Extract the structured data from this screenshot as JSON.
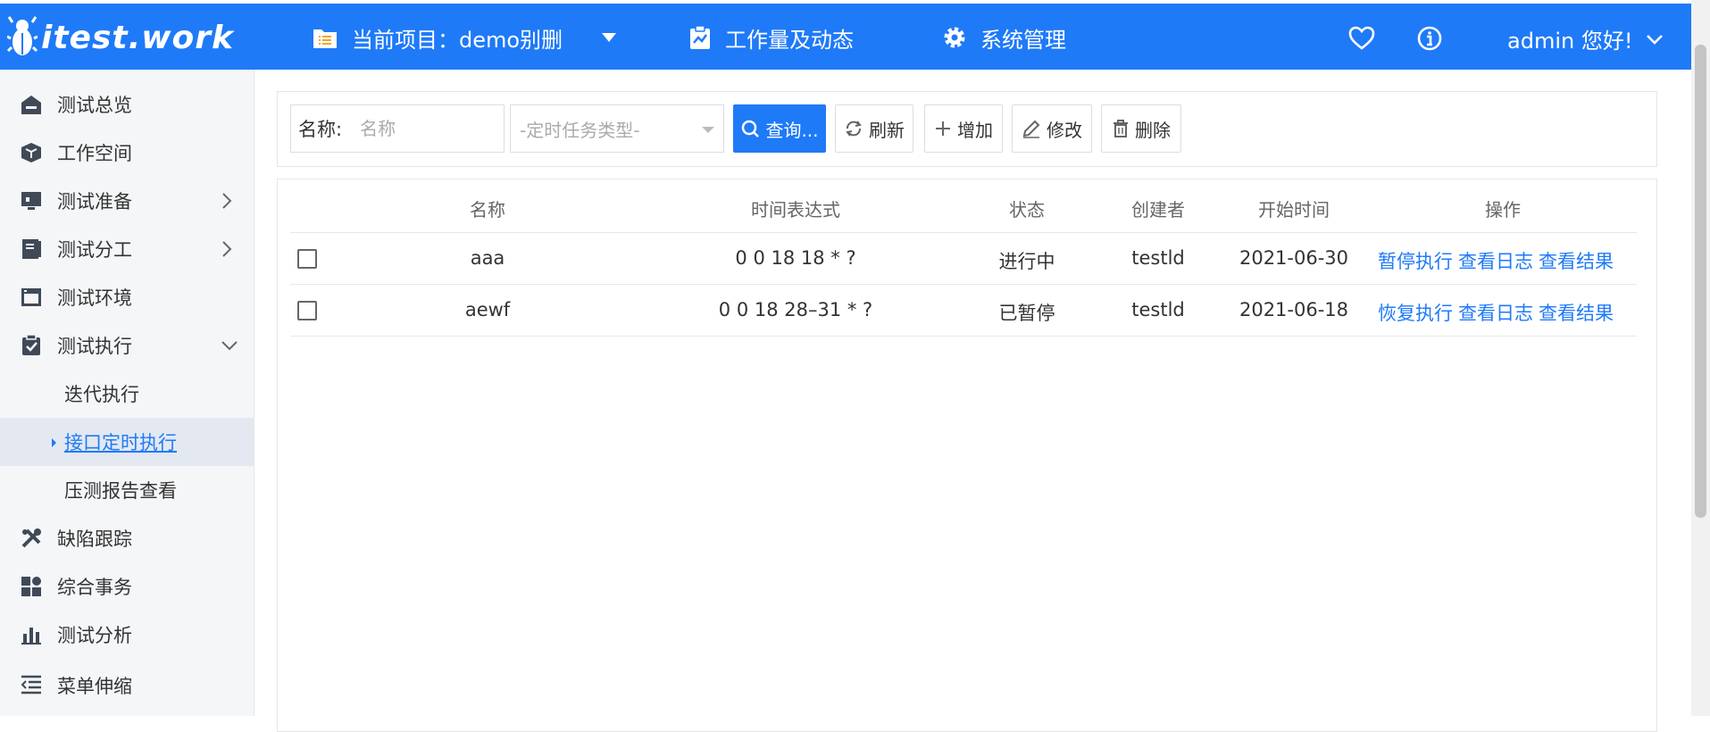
{
  "header": {
    "logo_text": "itest.work",
    "project_label": "当前项目：demo别删",
    "work_label": "工作量及动态",
    "system_label": "系统管理",
    "user_label": "admin 您好!",
    "brand_color": "#1f7af8"
  },
  "sidebar": {
    "items": [
      {
        "label": "测试总览",
        "icon": "home-icon"
      },
      {
        "label": "工作空间",
        "icon": "cube-icon"
      },
      {
        "label": "测试准备",
        "icon": "monitor-icon",
        "has_children": true
      },
      {
        "label": "测试分工",
        "icon": "book-icon",
        "has_children": true
      },
      {
        "label": "测试环境",
        "icon": "window-icon"
      },
      {
        "label": "测试执行",
        "icon": "clipboard-check-icon",
        "expanded": true
      },
      {
        "label": "缺陷跟踪",
        "icon": "tools-icon"
      },
      {
        "label": "综合事务",
        "icon": "grid-icon"
      },
      {
        "label": "测试分析",
        "icon": "bar-chart-icon"
      }
    ],
    "sub_items": [
      {
        "label": "迭代执行"
      },
      {
        "label": "接口定时执行",
        "active": true
      },
      {
        "label": "压测报告查看"
      }
    ],
    "collapse_label": "菜单伸缩"
  },
  "search": {
    "name_label": "名称:",
    "name_placeholder": "名称",
    "type_placeholder": "-定时任务类型-",
    "query_label": "查询...",
    "refresh_label": "刷新",
    "add_label": "增加",
    "edit_label": "修改",
    "delete_label": "删除"
  },
  "table": {
    "columns": [
      "名称",
      "时间表达式",
      "状态",
      "创建者",
      "开始时间",
      "操作"
    ],
    "rows": [
      {
        "name": "aaa",
        "cron": "0 0 18 18 * ?",
        "status": "进行中",
        "creator": "testld",
        "start": "2021-06-30",
        "ops": [
          "暂停执行",
          "查看日志",
          "查看结果"
        ]
      },
      {
        "name": "aewf",
        "cron": "0 0 18 28–31 * ?",
        "status": "已暂停",
        "creator": "testld",
        "start": "2021-06-18",
        "ops": [
          "恢复执行",
          "查看日志",
          "查看结果"
        ]
      }
    ]
  }
}
